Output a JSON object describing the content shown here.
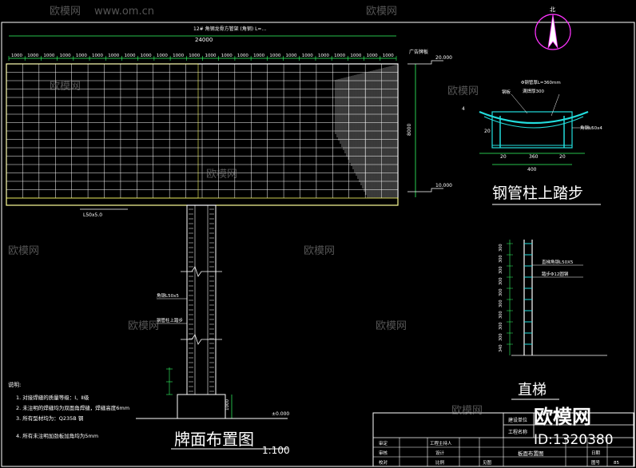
{
  "colors": {
    "background": "#000000",
    "frame": "#ffffff",
    "dimension": "#33ff66",
    "steel": "#22dddd",
    "cyan_text": "#66ffff",
    "north_arrow": "#ff33ff",
    "watermark": "#9a9a9a"
  },
  "billboard": {
    "total_width_dim": "24000",
    "top_note": "12# 角钢龙骨方管架 (角钢) L=…",
    "segment_dims": [
      "1000",
      "1000",
      "1000",
      "1000",
      "1000",
      "1000",
      "1000",
      "1000",
      "1000",
      "1000",
      "1000",
      "1000",
      "1000",
      "1000",
      "1000",
      "1000",
      "1000",
      "1000",
      "1000",
      "1000",
      "1000",
      "1000",
      "1000",
      "1000"
    ],
    "right_top_label": "广告牌板",
    "elev_top": "20.000",
    "elev_mid": "10.000",
    "height_dim": "8000",
    "bottom_left_label": "L50x5.0",
    "title": "牌面布置图",
    "scale": "1:100"
  },
  "column": {
    "left_label_1": "角钢L50x5",
    "left_label_2": "钢管柱上踏步",
    "base_dim": "1000",
    "ground_elev": "±0.000"
  },
  "step_detail": {
    "title": "钢管柱上踏步",
    "label_plate": "钢板",
    "label_pipe": "Φ钢管厚L=360mm",
    "label_weld": "满焊厚300",
    "label_rod": "角钢L50x4",
    "dim_top": "4",
    "dim_side": "20",
    "dim_inner": "360",
    "dim_total": "400",
    "dim_edge_l": "20",
    "dim_edge_r": "20"
  },
  "ladder": {
    "title": "直梯",
    "label_1": "直梯角钢L50X5",
    "label_2": "踏步Φ12圆钢",
    "dims": [
      "300",
      "300",
      "300",
      "300",
      "300",
      "300",
      "300",
      "300",
      "300",
      "340"
    ]
  },
  "north": {
    "label": "北"
  },
  "notes": {
    "heading": "说明:",
    "items": [
      "1. 对接焊缝的质量等级：Ⅰ、Ⅱ级",
      "2. 未注明的焊缝均为双面角焊缝，焊缝高度6mm",
      "3. 所有型材均为：Q235B 钢",
      "4. 所有未注明加劲板加角均为5mm"
    ]
  },
  "title_block": {
    "project_unit_label": "建设单位",
    "project_name_label": "工程名称",
    "drawing_name": "板面布置图",
    "rows": [
      [
        "审定",
        "",
        "工程主持人",
        ""
      ],
      [
        "审核",
        "",
        "设计",
        ""
      ],
      [
        "校对",
        "",
        "比例",
        "见图"
      ]
    ],
    "right_labels": [
      "日期",
      "图号"
    ],
    "sheet_no": "85"
  },
  "watermarks": {
    "brand": "欧模网",
    "url": "www.om.cn",
    "corner_brand": "欧模网",
    "corner_id": "ID:1320380"
  }
}
